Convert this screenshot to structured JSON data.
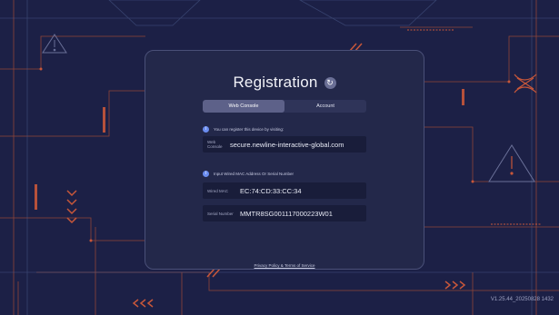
{
  "dialog": {
    "title": "Registration",
    "refresh_icon": "refresh-icon",
    "tabs": [
      {
        "label": "Web Console",
        "active": true
      },
      {
        "label": "Account",
        "active": false
      }
    ],
    "web_console": {
      "info_text": "You can register this device by visiting:",
      "label": "Web Console",
      "url": "secure.newline-interactive-global.com"
    },
    "device": {
      "info_text": "Input Wired MAC Address Or Serial Number",
      "wired_mac_label": "Wired MAC",
      "wired_mac_value": "EC:74:CD:33:CC:34",
      "serial_label": "Serial Number",
      "serial_value": "MMTR8SG001117000223W01"
    },
    "privacy_link": "Privacy Policy & Terms of Service"
  },
  "footer": {
    "version": "V1.25.44_20250828 1432"
  },
  "colors": {
    "background": "#1c2046",
    "card": "#23284a",
    "accent": "#6b8df0",
    "circuit": "#c8573a"
  }
}
